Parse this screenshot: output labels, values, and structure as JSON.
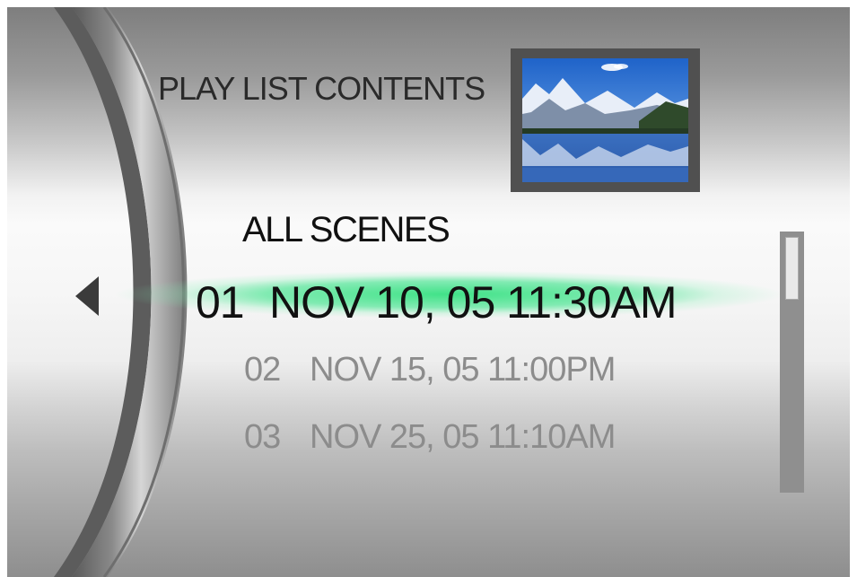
{
  "screen": {
    "title": "PLAY LIST CONTENTS",
    "thumbnail_icon": "mountain-lake-thumbnail",
    "all_scenes_label": "ALL SCENES",
    "scenes": [
      {
        "number": "01",
        "datetime": "NOV 10, 05 11:30AM",
        "selected": true
      },
      {
        "number": "02",
        "datetime": "NOV 15, 05 11:00PM",
        "selected": false
      },
      {
        "number": "03",
        "datetime": "NOV 25, 05 11:10AM",
        "selected": false
      }
    ],
    "highlight_color": "#3fe08a",
    "nav_icon": "triangle-left-icon"
  }
}
